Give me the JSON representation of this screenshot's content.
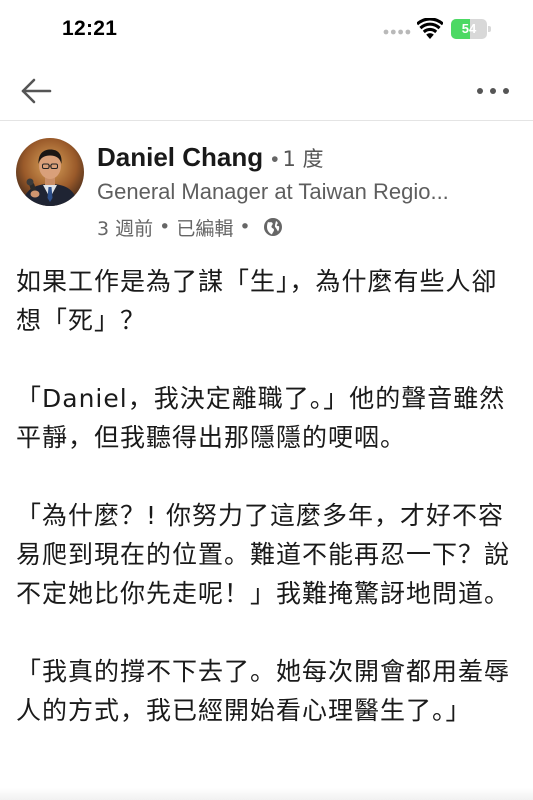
{
  "status_bar": {
    "time": "12:21",
    "battery_level": "54",
    "battery_fraction": 0.54,
    "icons": [
      "signal-dots-icon",
      "wifi-icon",
      "battery-icon"
    ]
  },
  "nav": {
    "back_icon": "arrow-left-icon",
    "more_icon": "more-horizontal-icon"
  },
  "post": {
    "author": {
      "name": "Daniel Chang",
      "separator": "•",
      "degree": "1 度",
      "headline": "General Manager at Taiwan Regio...",
      "avatar_icon": "profile-photo"
    },
    "meta": {
      "time_ago": "3 週前",
      "separator": "•",
      "edited": "已編輯",
      "visibility_icon": "globe-icon"
    },
    "paragraphs": [
      "如果工作是為了謀「生」，為什麼有些人卻想「死」？",
      "「Daniel，我決定離職了。」他的聲音雖然平靜，但我聽得出那隱隱的哽咽。",
      "「為什麼？! 你努力了這麼多年，才好不容易爬到現在的位置。難道不能再忍一下？說不定她比你先走呢！」我難掩驚訝地問道。",
      "「我真的撐不下去了。她每次開會都用羞辱人的方式，我已經開始看心理醫生了。」"
    ]
  },
  "colors": {
    "battery_green": "#4cd964",
    "text_primary": "#1a1a1a",
    "text_secondary": "#666666",
    "divider": "#e4e4e4"
  }
}
